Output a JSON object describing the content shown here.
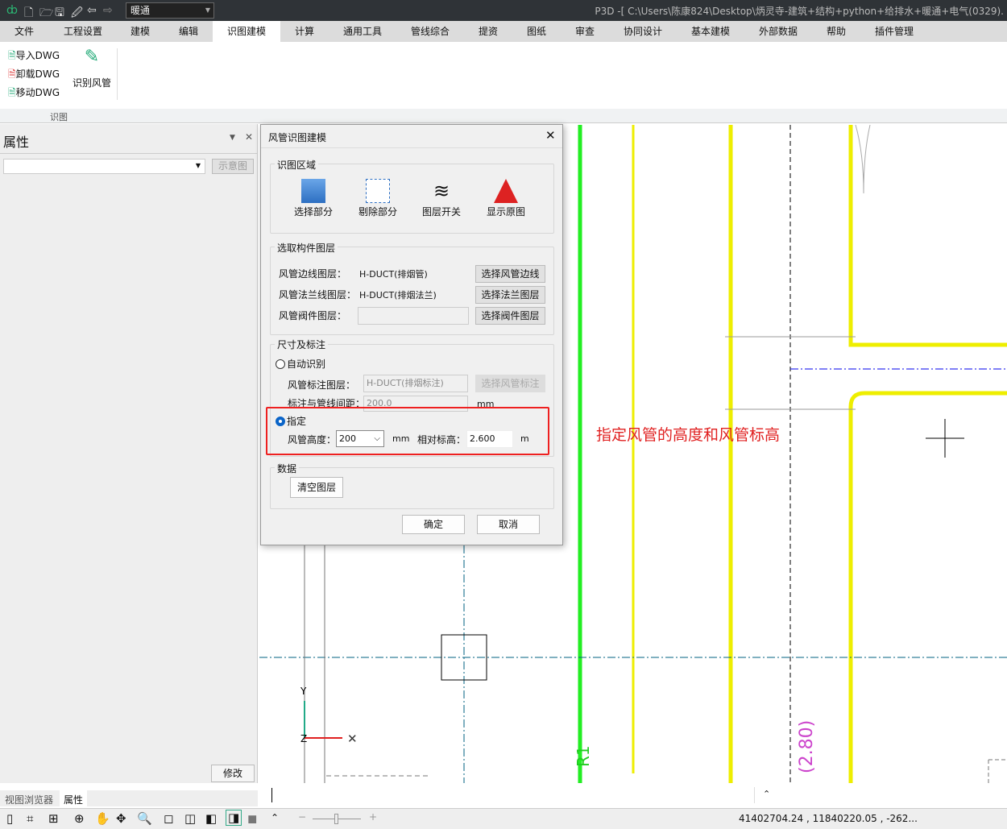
{
  "titlebar": {
    "discipline": "暖通",
    "window_title": "P3D -[ C:\\Users\\陈康824\\Desktop\\炳灵寺-建筑+结构+python+给排水+暖通+电气(0329)."
  },
  "menu": [
    "文件",
    "工程设置",
    "建模",
    "编辑",
    "识图建模",
    "计算",
    "通用工具",
    "管线综合",
    "提资",
    "图纸",
    "审查",
    "协同设计",
    "基本建模",
    "外部数据",
    "帮助",
    "插件管理"
  ],
  "ribbon": {
    "import": "导入DWG",
    "unload": "卸载DWG",
    "move": "移动DWG",
    "recognize_duct": "识别风管",
    "group": "识图"
  },
  "left_panel": {
    "title": "属性",
    "diagram_btn": "示意图",
    "modify_btn": "修改",
    "tabs": [
      "视图浏览器",
      "属性"
    ]
  },
  "dialog": {
    "title": "风管识图建模",
    "area_group": "识图区域",
    "tools": [
      "选择部分",
      "剔除部分",
      "图层开关",
      "显示原图"
    ],
    "layer_group": "选取构件图层",
    "layers": [
      {
        "label": "风管边线图层：",
        "value": "H-DUCT(排烟管)",
        "button": "选择风管边线"
      },
      {
        "label": "风管法兰线图层：",
        "value": "H-DUCT(排烟法兰)",
        "button": "选择法兰图层"
      },
      {
        "label": "风管阀件图层：",
        "value": "",
        "button": "选择阀件图层"
      }
    ],
    "size_group": "尺寸及标注",
    "auto_label": "自动识别",
    "annot_layer_label": "风管标注图层：",
    "annot_layer_value": "H-DUCT(排烟标注)",
    "annot_button": "选择风管标注",
    "gap_label": "标注与管线间距：",
    "gap_value": "200.0",
    "gap_unit": "mm",
    "specify_label": "指定",
    "height_label": "风管高度：",
    "height_value": "200",
    "height_unit": "mm",
    "elev_label": "相对标高：",
    "elev_value": "2.600",
    "elev_unit": "m",
    "data_group": "数据",
    "clear_btn": "清空图层",
    "ok": "确定",
    "cancel": "取消"
  },
  "annotation": "指定风管的高度和风管标高",
  "canvas_text": {
    "r1": "R1",
    "dim": "(2.80)",
    "axis_y": "Y",
    "axis_z": "Z"
  },
  "status": {
    "coords": "41402704.24 , 11840220.05 , -262..."
  }
}
